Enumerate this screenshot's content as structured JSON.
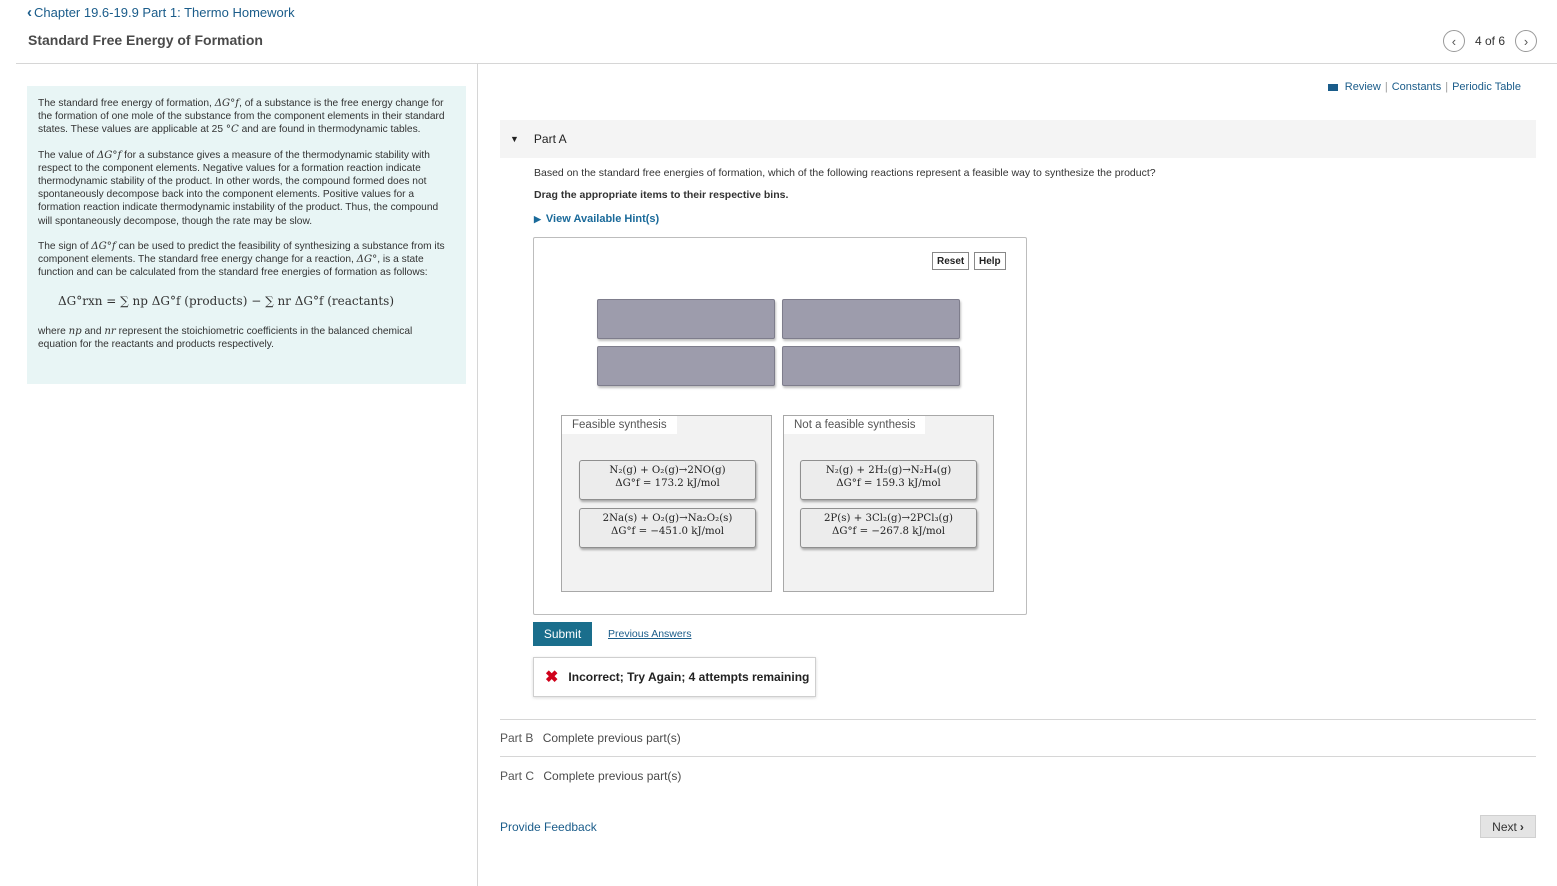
{
  "breadcrumb": {
    "icon": "chevron-left-icon",
    "label": "Chapter 19.6-19.9 Part 1: Thermo Homework"
  },
  "page_title": "Standard Free Energy of Formation",
  "pager": {
    "prev_icon": "chevron-left-icon",
    "label": "4 of 6",
    "next_icon": "chevron-right-icon"
  },
  "intro": {
    "p1_a": "The standard free energy of formation, ",
    "p1_b": ", of a substance is the free energy change for the formation of one mole of the substance from the component elements in their standard states. These values are applicable at 25 ",
    "p1_c": " and are found in thermodynamic tables.",
    "p2_a": "The value of ",
    "p2_b": " for a substance gives a measure of the thermodynamic stability with respect to the component elements. Negative values for a formation reaction indicate thermodynamic stability of the product. In other words, the compound formed does not spontaneously decompose back into the component elements. Positive values for a formation reaction indicate thermodynamic instability of the product. Thus, the compound will spontaneously decompose, though the rate may be slow.",
    "p3_a": "The sign of ",
    "p3_b": " can be used to predict the feasibility of synthesizing a substance from its component elements. The standard free energy change for a reaction, ",
    "p3_c": ", is a state function and can be calculated from the standard free energies of formation as follows:",
    "equation": "ΔG°rxn = ∑ np ΔG°f (products) − ∑ nr ΔG°f (reactants)",
    "p4_a": "where ",
    "p4_b": " and ",
    "p4_c": " represent the stoichiometric coefficients in the balanced chemical equation for the reactants and products respectively.",
    "sym_dgf": "ΔG°f",
    "sym_degc": "°C",
    "sym_dg": "ΔG°",
    "sym_np": "np",
    "sym_nr": "nr"
  },
  "top_links": {
    "review": "Review",
    "constants": "Constants",
    "periodic": "Periodic Table",
    "sep": "|"
  },
  "part_a": {
    "label": "Part A",
    "question": "Based on the standard free energies of formation, which of the following reactions represent a feasible way to synthesize the product?",
    "instruction": "Drag the appropriate items to their respective bins.",
    "hint": "View Available Hint(s)",
    "reset": "Reset",
    "help": "Help",
    "bins": [
      {
        "label": "Feasible synthesis",
        "items": [
          {
            "reaction": "N₂(g) + O₂(g)→2NO(g)",
            "dg": "ΔG°f = 173.2 kJ/mol"
          },
          {
            "reaction": "2Na(s) + O₂(g)→Na₂O₂(s)",
            "dg": "ΔG°f = −451.0 kJ/mol"
          }
        ]
      },
      {
        "label": "Not a feasible synthesis",
        "items": [
          {
            "reaction": "N₂(g) + 2H₂(g)→N₂H₄(g)",
            "dg": "ΔG°f = 159.3 kJ/mol"
          },
          {
            "reaction": "2P(s) + 3Cl₂(g)→2PCl₃(g)",
            "dg": "ΔG°f = −267.8 kJ/mol"
          }
        ]
      }
    ],
    "submit": "Submit",
    "previous_answers": "Previous Answers",
    "feedback": "Incorrect; Try Again; 4 attempts remaining"
  },
  "part_b": {
    "label": "Part B",
    "status": "Complete previous part(s)"
  },
  "part_c": {
    "label": "Part C",
    "status": "Complete previous part(s)"
  },
  "footer": {
    "provide_feedback": "Provide Feedback",
    "next": "Next"
  }
}
